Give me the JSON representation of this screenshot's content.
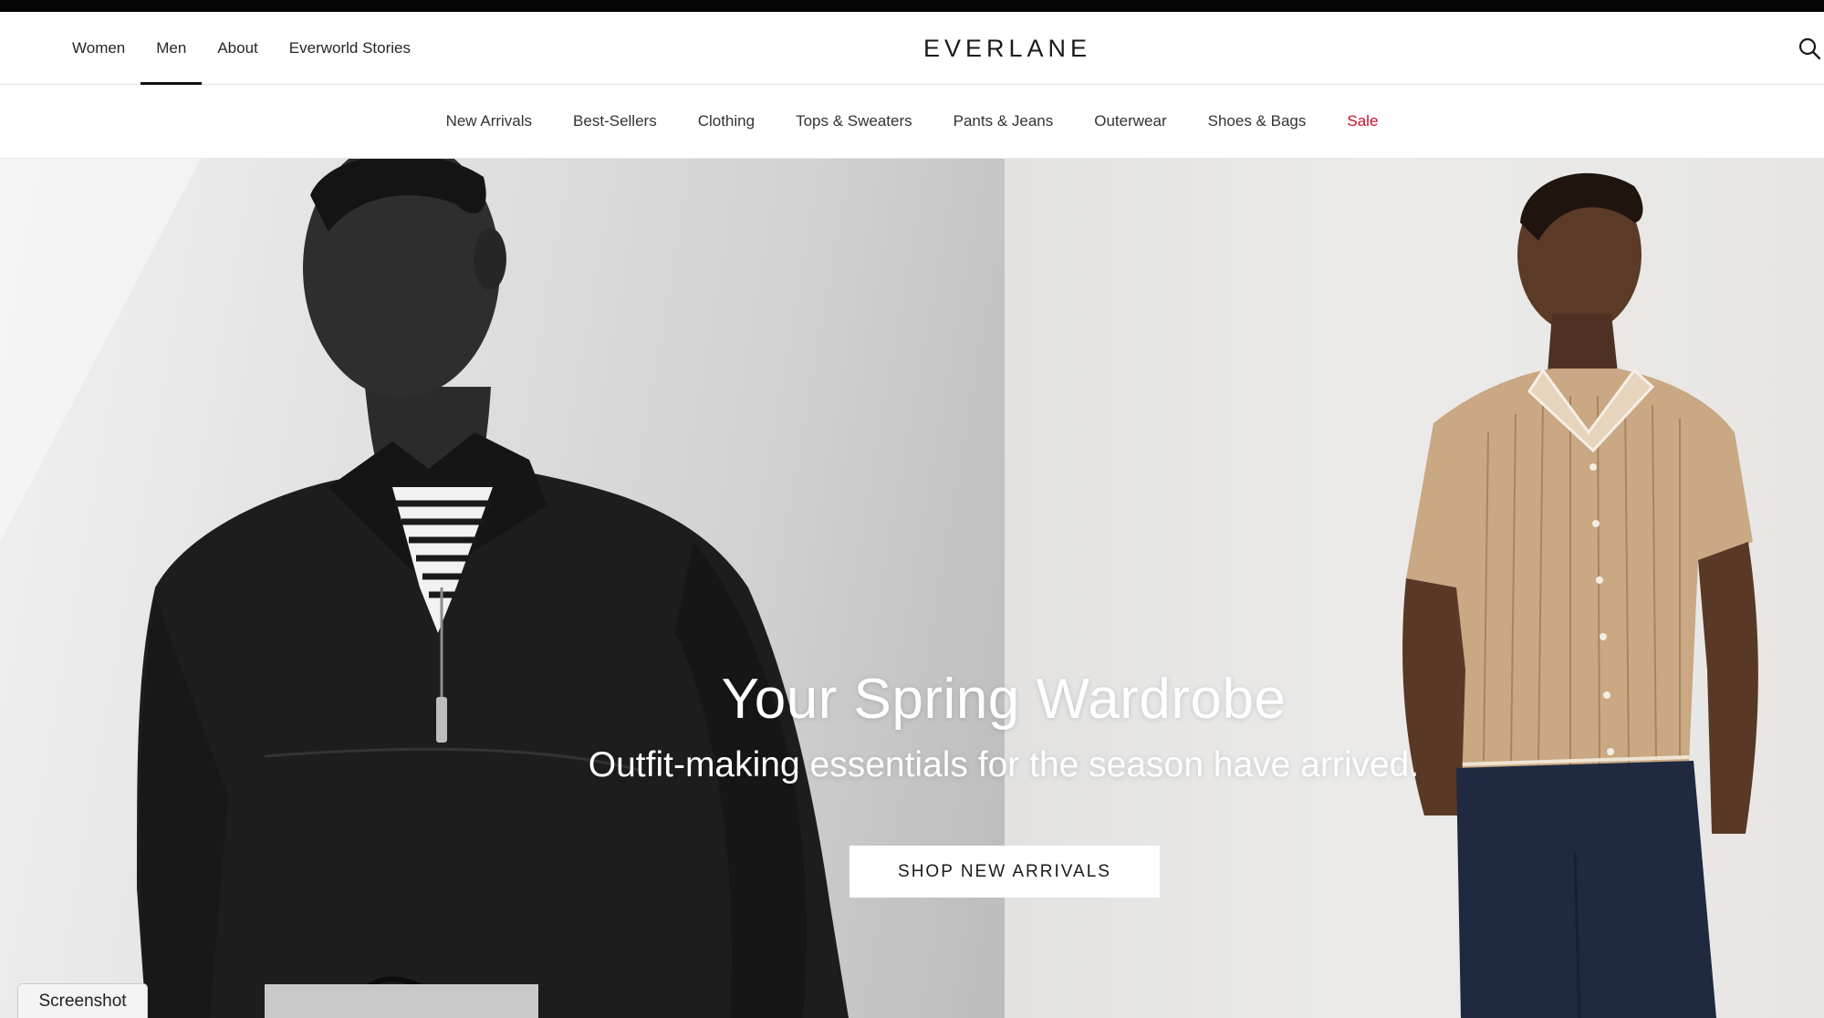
{
  "brand": {
    "logo_text": "EVERLANE"
  },
  "primary_nav": {
    "items": [
      {
        "label": "Women",
        "active": false
      },
      {
        "label": "Men",
        "active": true
      },
      {
        "label": "About",
        "active": false
      },
      {
        "label": "Everworld Stories",
        "active": false
      }
    ]
  },
  "header_icons": {
    "search": "search-icon"
  },
  "category_nav": {
    "items": [
      {
        "label": "New Arrivals"
      },
      {
        "label": "Best-Sellers"
      },
      {
        "label": "Clothing"
      },
      {
        "label": "Tops & Sweaters"
      },
      {
        "label": "Pants & Jeans"
      },
      {
        "label": "Outerwear"
      },
      {
        "label": "Shoes & Bags"
      },
      {
        "label": "Sale",
        "highlight_color": "#c8102e"
      }
    ]
  },
  "hero": {
    "title": "Your Spring Wardrobe",
    "subtitle": "Outfit-making essentials for the season have arrived.",
    "cta_label": "SHOP NEW ARRIVALS",
    "left_image": "model-black-quarter-zip",
    "right_image": "model-tan-knit-polo"
  },
  "overlay": {
    "screenshot_label": "Screenshot"
  },
  "colors": {
    "top_bar": "#050505",
    "sale": "#c8102e",
    "text": "#262626",
    "cta_background": "#ffffff"
  }
}
